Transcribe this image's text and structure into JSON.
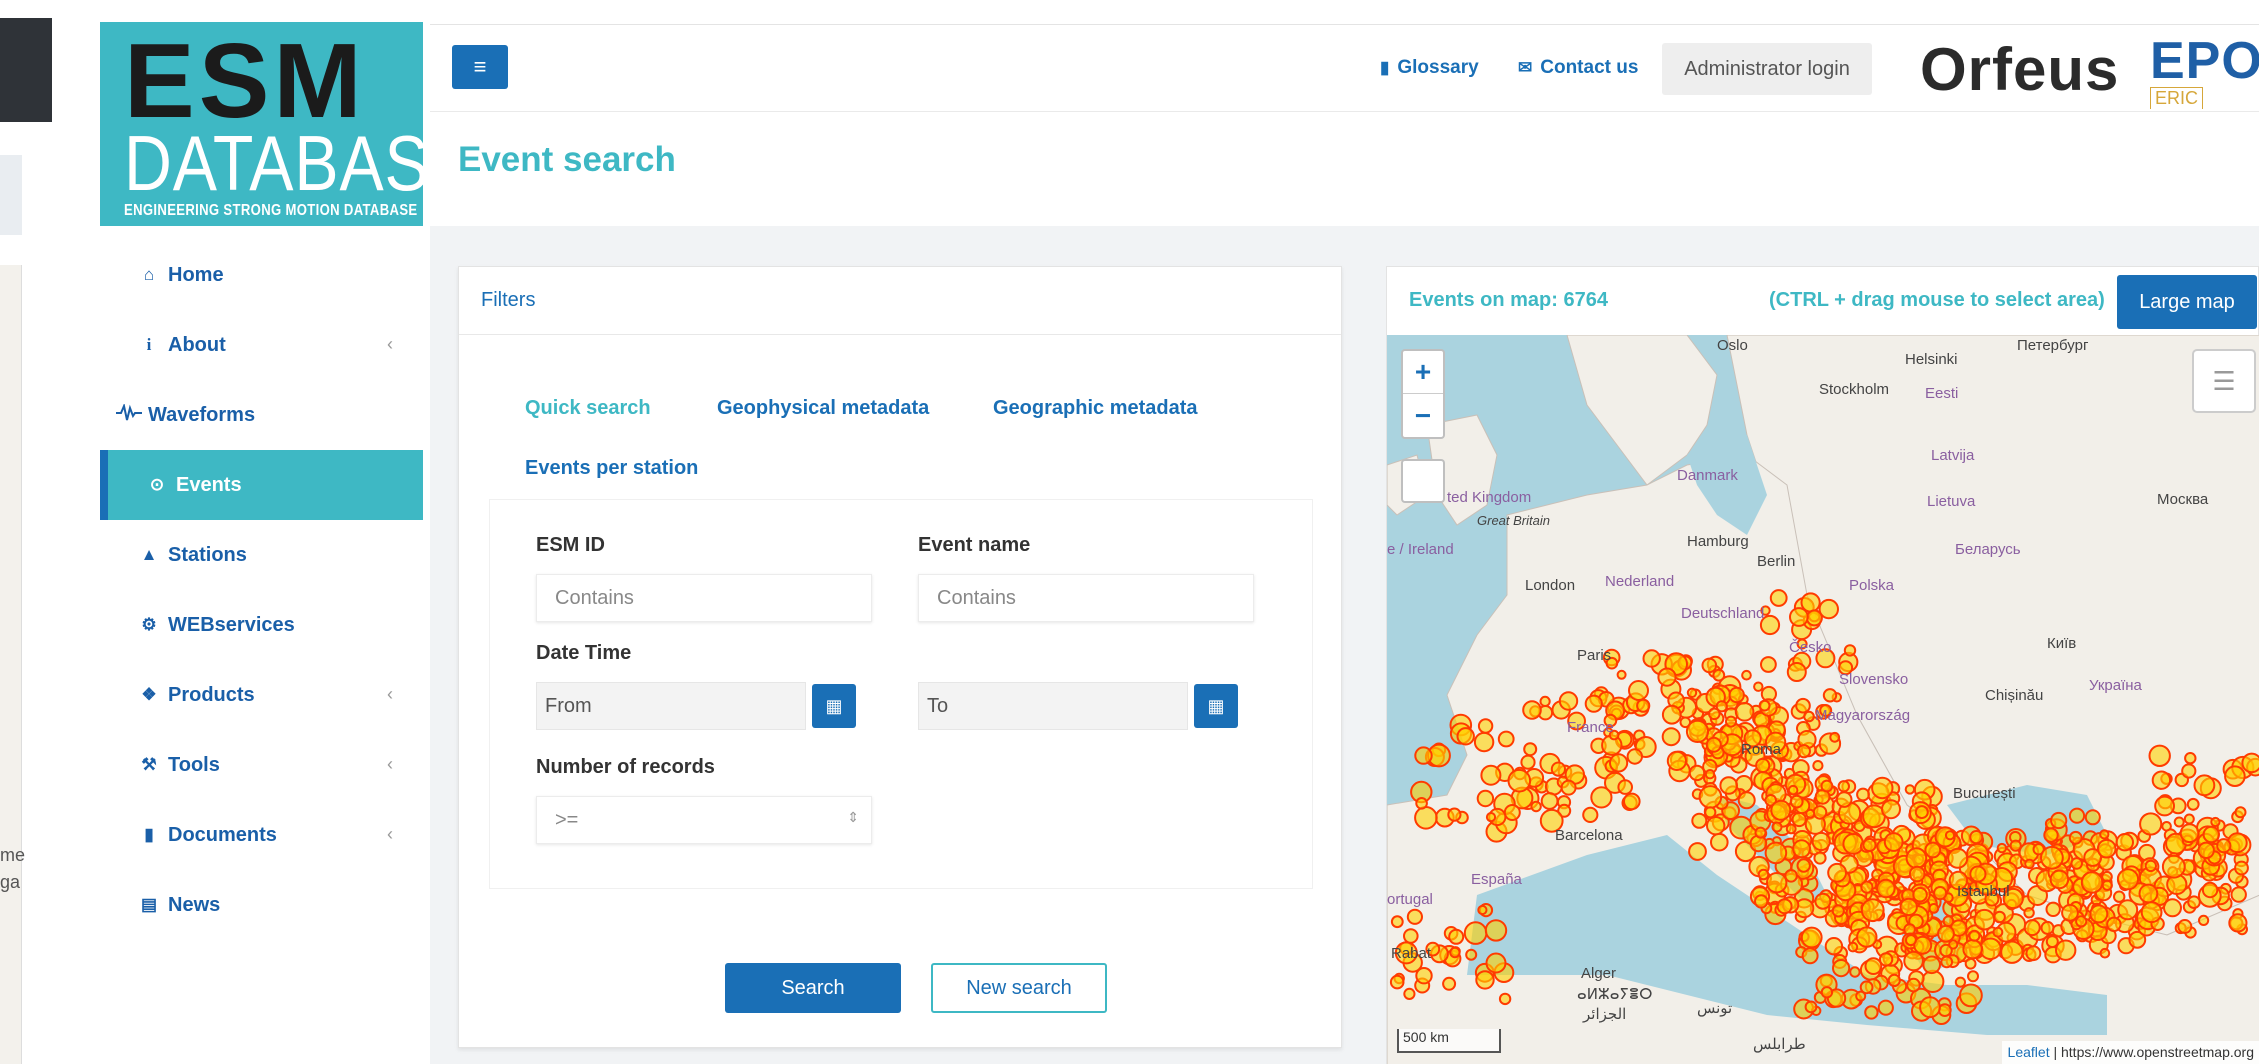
{
  "logo": {
    "line1": "ESM",
    "line2": "DATABASE",
    "tagline": "ENGINEERING STRONG MOTION DATABASE"
  },
  "sidebar": {
    "items": [
      {
        "label": "Home",
        "icon": "home-icon",
        "has_submenu": false
      },
      {
        "label": "About",
        "icon": "info-icon",
        "has_submenu": true
      },
      {
        "label": "Waveforms",
        "icon": "waveform-icon",
        "has_submenu": false
      },
      {
        "label": "Events",
        "icon": "circle-dot-icon",
        "has_submenu": false,
        "active": true
      },
      {
        "label": "Stations",
        "icon": "triangle-icon",
        "has_submenu": false
      },
      {
        "label": "WEBservices",
        "icon": "cogs-icon",
        "has_submenu": false
      },
      {
        "label": "Products",
        "icon": "cubes-icon",
        "has_submenu": true
      },
      {
        "label": "Tools",
        "icon": "wrench-icon",
        "has_submenu": true
      },
      {
        "label": "Documents",
        "icon": "file-icon",
        "has_submenu": true
      },
      {
        "label": "News",
        "icon": "newspaper-icon",
        "has_submenu": false
      }
    ]
  },
  "header": {
    "glossary": "Glossary",
    "contact": "Contact us",
    "admin_login": "Administrator login",
    "partner_logo_1": "Orfeus",
    "partner_logo_2": "EPOS",
    "partner_logo_2_sub": "ERIC"
  },
  "page": {
    "title": "Event search"
  },
  "filters": {
    "heading": "Filters",
    "tabs": [
      "Quick search",
      "Geophysical metadata",
      "Geographic metadata",
      "Events per station"
    ],
    "active_tab": "Quick search",
    "esm_id_label": "ESM ID",
    "esm_id_placeholder": "Contains",
    "event_name_label": "Event name",
    "event_name_placeholder": "Contains",
    "date_time_label": "Date Time",
    "from_placeholder": "From",
    "to_placeholder": "To",
    "records_label": "Number of records",
    "records_placeholder": ">=",
    "search_button": "Search",
    "new_search_button": "New search"
  },
  "map": {
    "events_on_map": "Events on map: 6764",
    "hint": "(CTRL + drag mouse to select area)",
    "large_map_button": "Large map",
    "zoom_in": "+",
    "zoom_out": "−",
    "scale": "500 km",
    "attribution_leaflet": "Leaflet",
    "attribution_source": " | https://www.openstreetmap.org",
    "labels": [
      "Oslo",
      "Helsinki",
      "Петербург",
      "Stockholm",
      "Eesti",
      "Latvija",
      "Danmark",
      "Lietuva",
      "Москва",
      "ted Kingdom",
      "Great Britain",
      "e / Ireland",
      "Hamburg",
      "Беларусь",
      "Berlin",
      "London",
      "Nederland",
      "Polska",
      "Deutschland",
      "Česko",
      "Київ",
      "Paris",
      "Slovensko",
      "Україна",
      "Chișinău",
      "France",
      "Magyarország",
      "Roma",
      "București",
      "Barcelona",
      "España",
      "ortugal",
      "Alger",
      "Istanbul",
      "ⴰⵍⵣⴰⵢⴻⵔ",
      "الجزائر",
      "تونس",
      "طرابلس",
      "Rabat"
    ],
    "colors": {
      "event_ring": "#ff3b00",
      "event_fill": "#ffd000",
      "water": "#aad3df",
      "land": "#f2efe9"
    }
  },
  "left_strip": {
    "text1": "me",
    "text2": "ga"
  },
  "colors": {
    "teal": "#3eb8c4",
    "blue": "#1a6fb6"
  }
}
